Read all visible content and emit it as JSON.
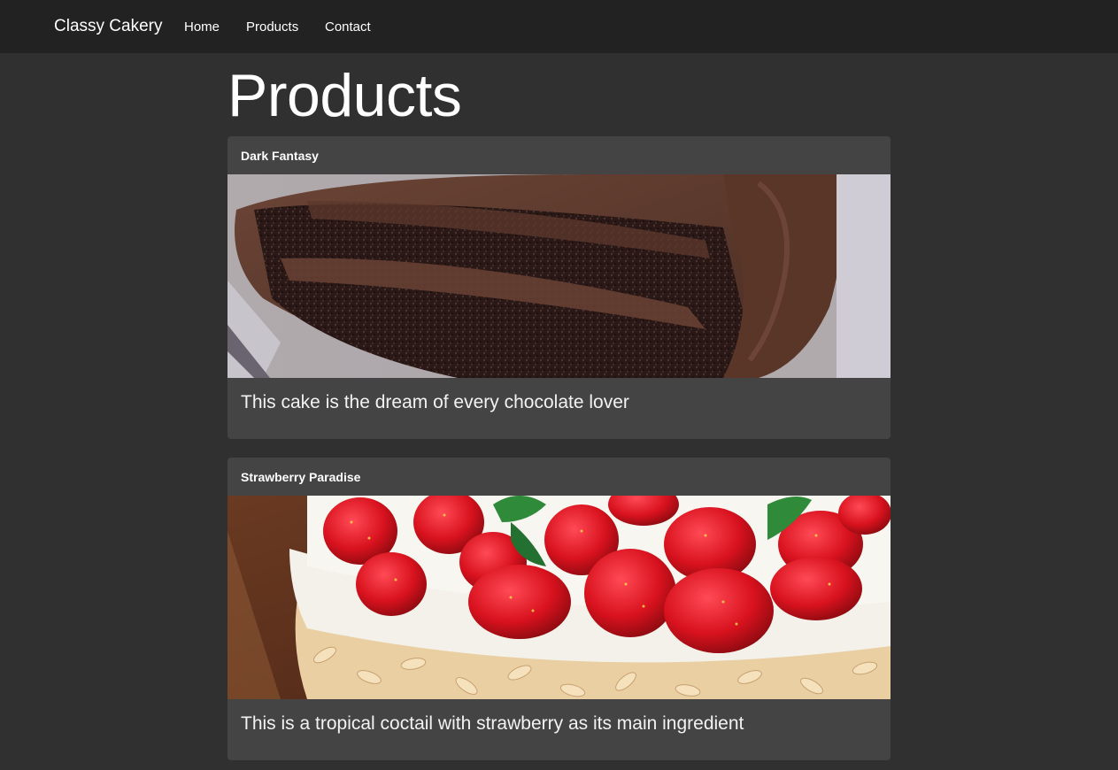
{
  "navbar": {
    "brand": "Classy Cakery",
    "links": [
      {
        "label": "Home"
      },
      {
        "label": "Products"
      },
      {
        "label": "Contact"
      }
    ]
  },
  "page": {
    "title": "Products"
  },
  "products": [
    {
      "name": "Dark Fantasy",
      "description": "This cake is the dream of every chocolate lover",
      "image_icon": "chocolate-cake-photo"
    },
    {
      "name": "Strawberry Paradise",
      "description": "This is a tropical coctail with strawberry as its main ingredient",
      "image_icon": "strawberry-cake-photo"
    }
  ],
  "colors": {
    "background": "#303030",
    "navbar": "#222222",
    "card": "#444444",
    "text": "#ffffff"
  }
}
